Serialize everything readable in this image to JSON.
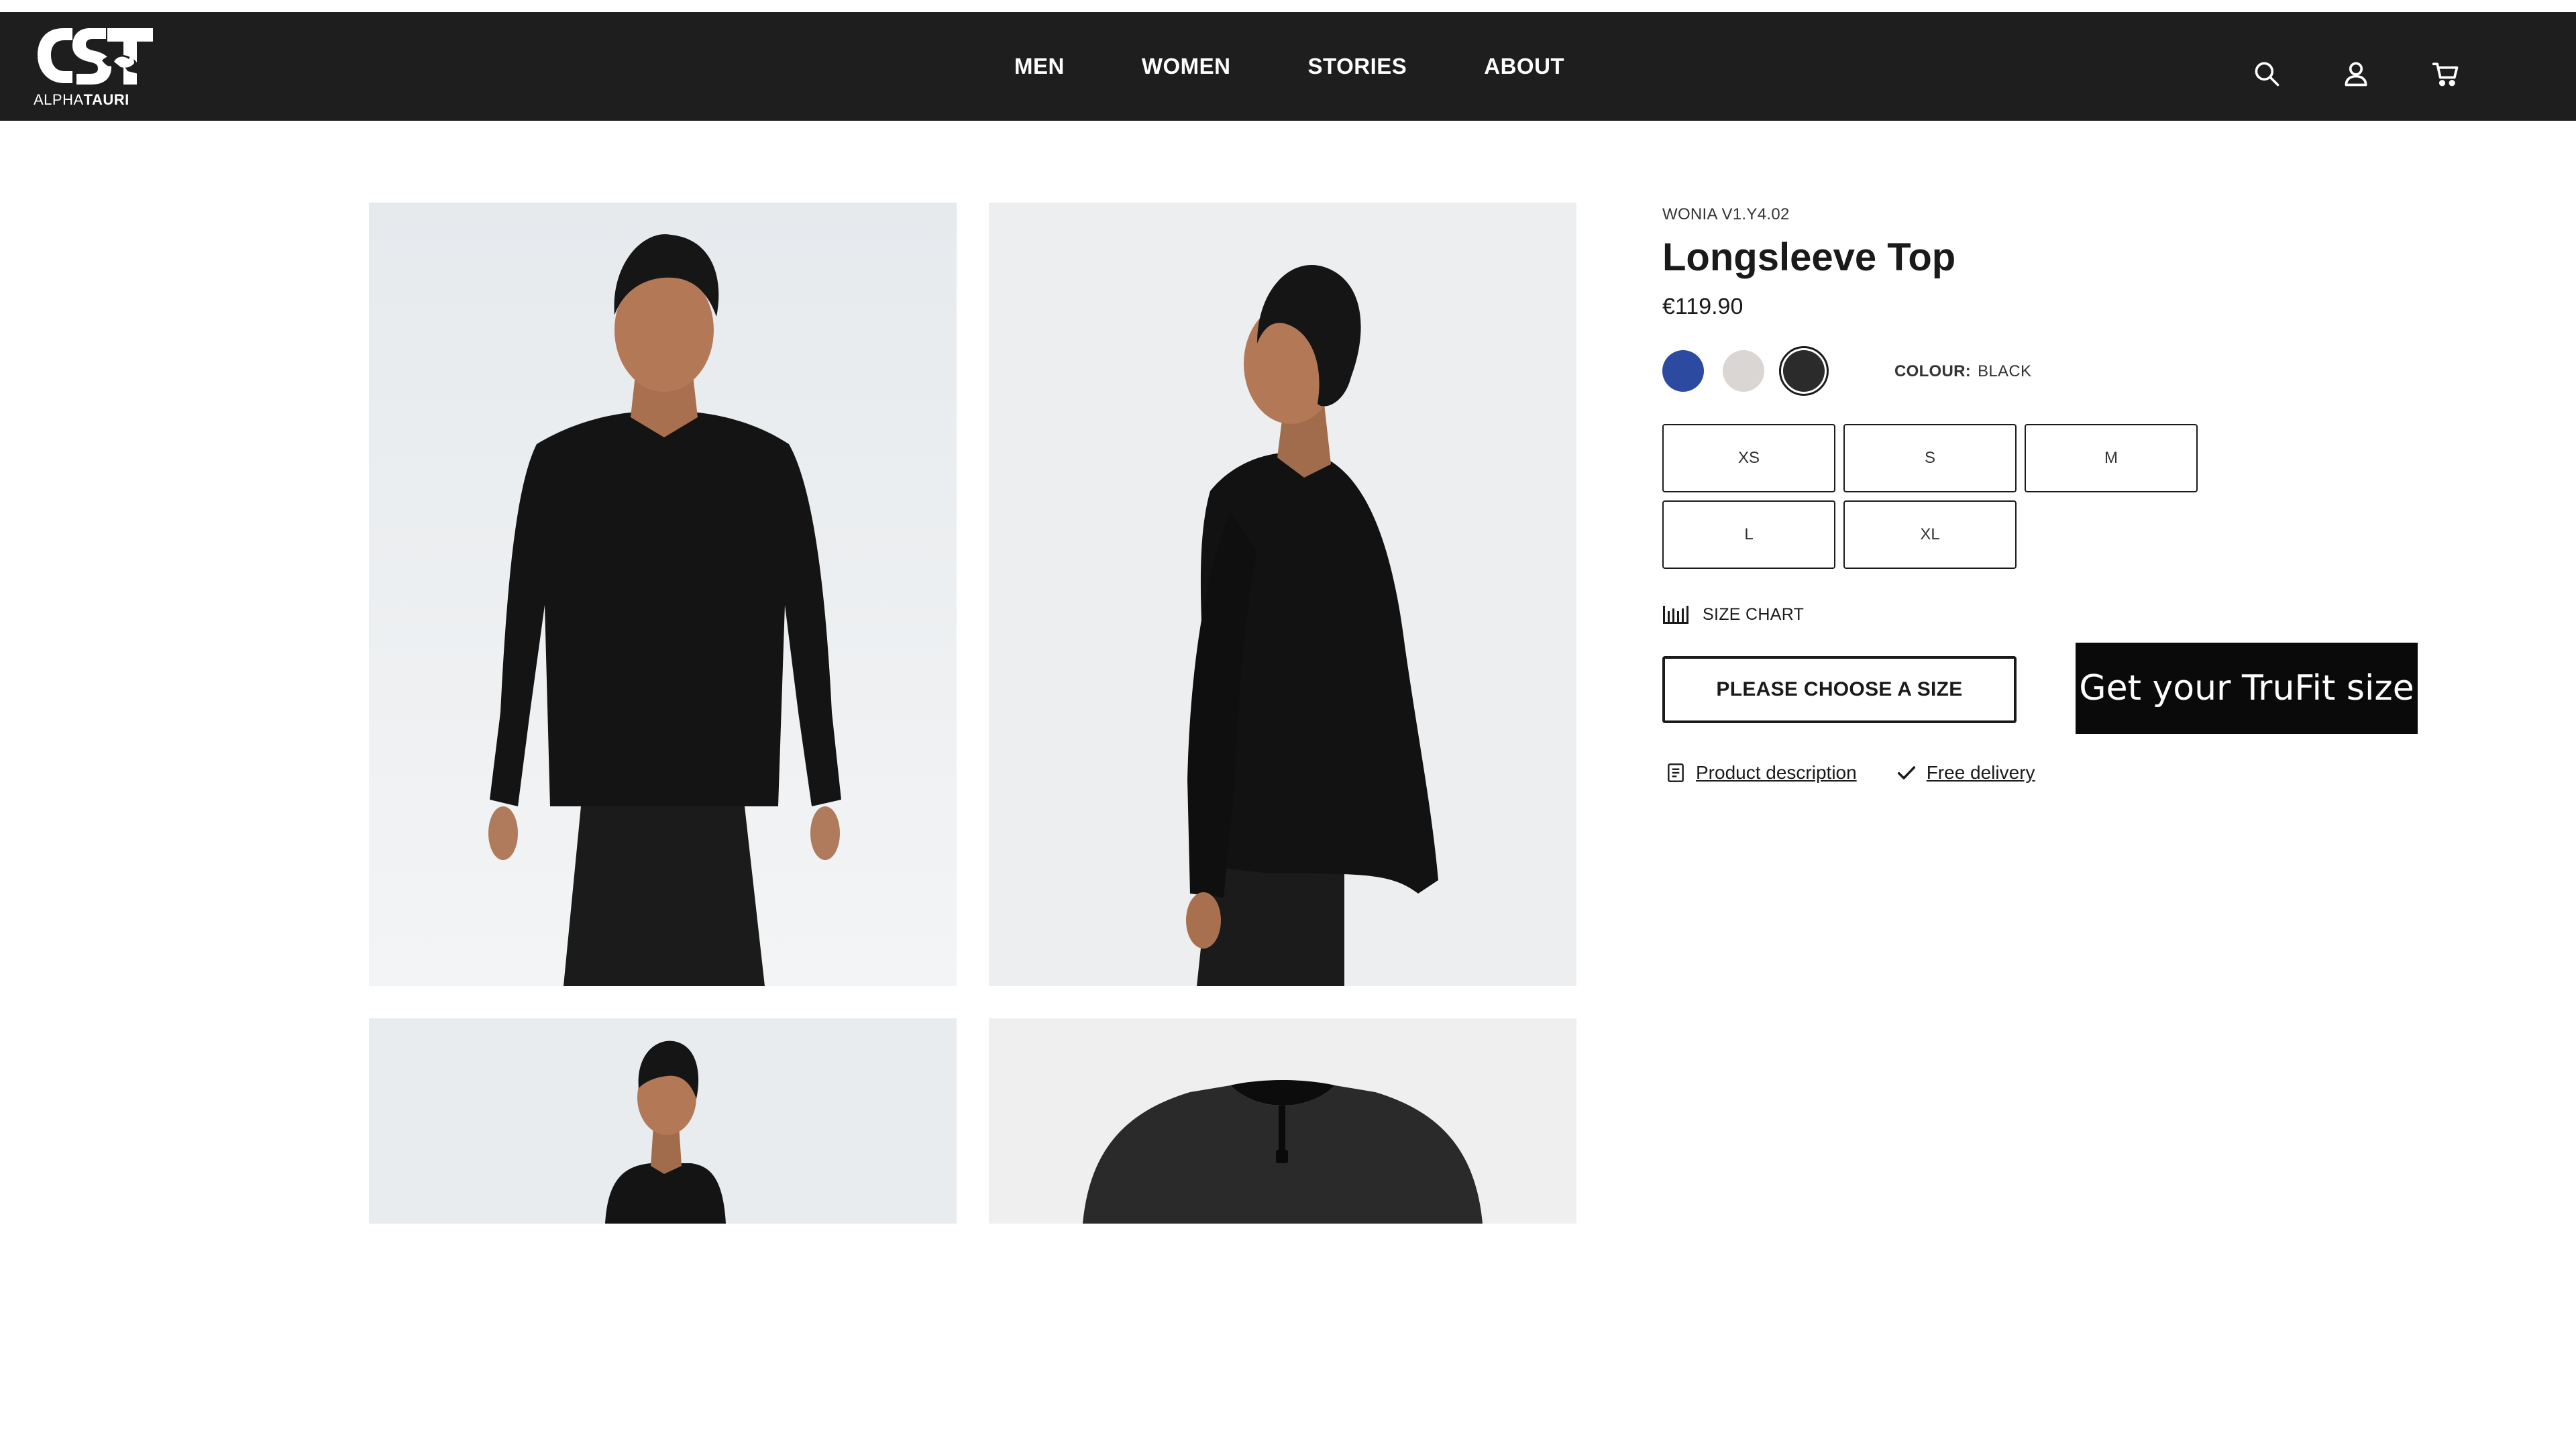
{
  "brand": {
    "logo_text_light": "ALPHA",
    "logo_text_bold": "TAURI"
  },
  "nav": {
    "items": [
      {
        "label": "MEN"
      },
      {
        "label": "WOMEN"
      },
      {
        "label": "STORIES"
      },
      {
        "label": "ABOUT"
      }
    ]
  },
  "header_icons": [
    "search-icon",
    "account-icon",
    "cart-icon"
  ],
  "gallery": {
    "images": [
      "front-view",
      "side-view",
      "model-view",
      "detail-view"
    ]
  },
  "product": {
    "sku": "WONIA V1.Y4.02",
    "title": "Longsleeve Top",
    "price": "€119.90",
    "colour_key": "COLOUR:",
    "colour_value": "BLACK",
    "swatches": [
      {
        "name": "blue",
        "color": "#2c4aa0"
      },
      {
        "name": "light-grey",
        "color": "#d9d6d3"
      },
      {
        "name": "black",
        "color": "#2b2b2b",
        "selected": true
      }
    ],
    "sizes": [
      {
        "label": "XS"
      },
      {
        "label": "S"
      },
      {
        "label": "M"
      },
      {
        "label": "L"
      },
      {
        "label": "XL"
      }
    ],
    "size_chart_label": "SIZE CHART",
    "choose_size_label": "PLEASE CHOOSE A SIZE",
    "trufit_label": "Get your TruFit size",
    "links": [
      {
        "label": "Product description",
        "icon": "document-icon"
      },
      {
        "label": "Free delivery",
        "icon": "checkmark-icon"
      }
    ]
  },
  "colors": {
    "header_bg": "#1e1e1e",
    "accent": "#0a0a0a"
  }
}
